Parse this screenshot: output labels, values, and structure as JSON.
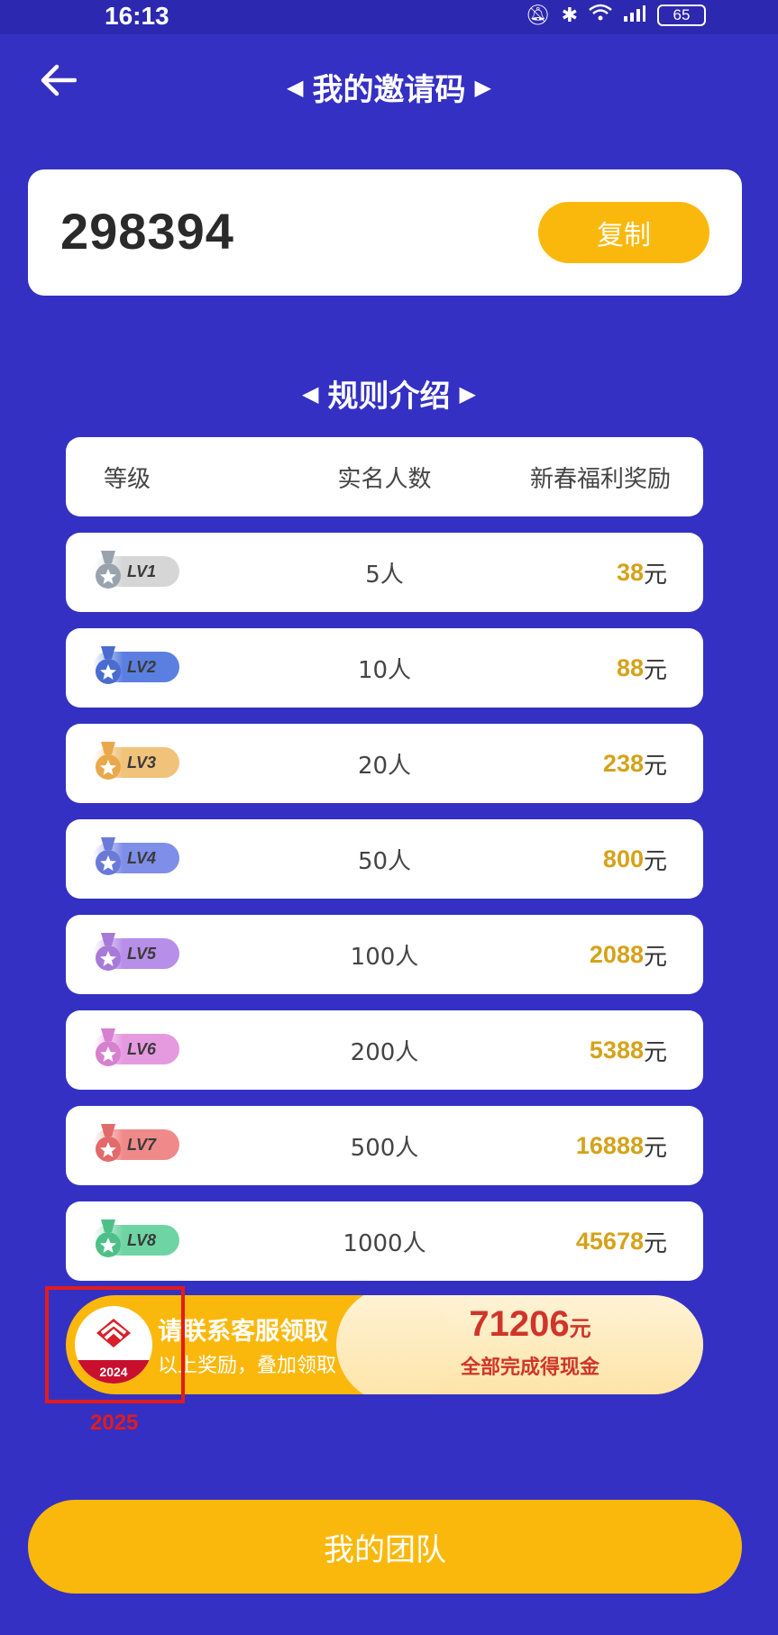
{
  "status": {
    "time": "16:13",
    "battery": "65"
  },
  "header": {
    "title": "我的邀请码"
  },
  "invite": {
    "code": "298394",
    "copy_label": "复制"
  },
  "rules": {
    "title": "规则介绍",
    "columns": [
      "等级",
      "实名人数",
      "新春福利奖励"
    ],
    "rows": [
      {
        "level": "LV1",
        "count": "5人",
        "reward": "38",
        "unit": "元",
        "color": "#d6d6d6",
        "medal": "#9aa3ad"
      },
      {
        "level": "LV2",
        "count": "10人",
        "reward": "88",
        "unit": "元",
        "color": "#5b7fe0",
        "medal": "#4a6bd0"
      },
      {
        "level": "LV3",
        "count": "20人",
        "reward": "238",
        "unit": "元",
        "color": "#f0c27a",
        "medal": "#e9a84a"
      },
      {
        "level": "LV4",
        "count": "50人",
        "reward": "800",
        "unit": "元",
        "color": "#7f8ee8",
        "medal": "#6a7ad8"
      },
      {
        "level": "LV5",
        "count": "100人",
        "reward": "2088",
        "unit": "元",
        "color": "#b78ee8",
        "medal": "#a77ad8"
      },
      {
        "level": "LV6",
        "count": "200人",
        "reward": "5388",
        "unit": "元",
        "color": "#e59ae0",
        "medal": "#d780d0"
      },
      {
        "level": "LV7",
        "count": "500人",
        "reward": "16888",
        "unit": "元",
        "color": "#f08a8a",
        "medal": "#e26a6a"
      },
      {
        "level": "LV8",
        "count": "1000人",
        "reward": "45678",
        "unit": "元",
        "color": "#6fd4a4",
        "medal": "#4fbf88"
      }
    ]
  },
  "bonus": {
    "line1": "请联系客服领取",
    "line2": "以上奖励，叠加领取",
    "amount": "71206",
    "amount_unit": "元",
    "note": "全部完成得现金",
    "logo_year": "2024"
  },
  "annotation": {
    "label": "2025",
    "color": "#e31b1b"
  },
  "footer": {
    "team_label": "我的团队"
  }
}
